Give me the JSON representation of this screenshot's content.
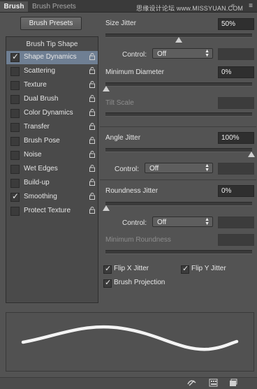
{
  "tabs": [
    {
      "label": "Brush"
    },
    {
      "label": "Brush Presets"
    }
  ],
  "watermark": "思缘设计论坛 www.MISSYUAN.COM",
  "brush_presets_button": "Brush Presets",
  "brush_tip_shape": "Brush Tip Shape",
  "options": [
    {
      "label": "Shape Dynamics",
      "checked": true
    },
    {
      "label": "Scattering",
      "checked": false
    },
    {
      "label": "Texture",
      "checked": false
    },
    {
      "label": "Dual Brush",
      "checked": false
    },
    {
      "label": "Color Dynamics",
      "checked": false
    },
    {
      "label": "Transfer",
      "checked": false
    },
    {
      "label": "Brush Pose",
      "checked": false
    },
    {
      "label": "Noise",
      "checked": false
    },
    {
      "label": "Wet Edges",
      "checked": false
    },
    {
      "label": "Build-up",
      "checked": false
    },
    {
      "label": "Smoothing",
      "checked": true
    },
    {
      "label": "Protect Texture",
      "checked": false
    }
  ],
  "size_jitter": {
    "label": "Size Jitter",
    "value": "50%",
    "level": 0.5
  },
  "control_label": "Control:",
  "control_1": "Off",
  "min_diameter": {
    "label": "Minimum Diameter",
    "value": "0%",
    "level": 0
  },
  "tilt_scale": {
    "label": "Tilt Scale"
  },
  "angle_jitter": {
    "label": "Angle Jitter",
    "value": "100%",
    "level": 1
  },
  "control_2": "Off",
  "roundness_jitter": {
    "label": "Roundness Jitter",
    "value": "0%",
    "level": 0
  },
  "control_3": "Off",
  "min_roundness": {
    "label": "Minimum Roundness"
  },
  "flip_x": {
    "label": "Flip X Jitter",
    "checked": true
  },
  "flip_y": {
    "label": "Flip Y Jitter",
    "checked": true
  },
  "brush_projection": {
    "label": "Brush Projection",
    "checked": true
  },
  "colors": {
    "selected_row": "#6f7f93",
    "panel": "#535353"
  }
}
